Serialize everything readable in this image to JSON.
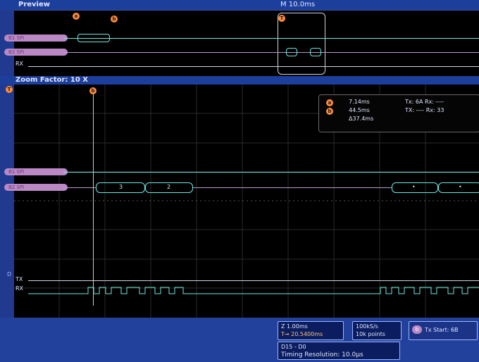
{
  "header": {
    "preview_label": "Preview",
    "time_scale": "M 10.0ms"
  },
  "preview": {
    "bus_b1": "B1 SPI",
    "bus_b2": "B2 SPI",
    "channel_rx": "RX"
  },
  "zoom": {
    "label": "Zoom Factor: 10 X"
  },
  "markers": {
    "a": "a",
    "b": "b",
    "t": "T"
  },
  "cursor_readout": {
    "line1": "7.14ms",
    "line2": "44.5ms",
    "line3": "Δ37.4ms",
    "col1a": "Tx: 6A Rx: ----",
    "col1b": "TX: ---- Rx: 33"
  },
  "bus_labels": {
    "b1": "B1 SPI",
    "b2": "B2 SPI"
  },
  "decode": {
    "packet1": "3",
    "packet2": "2",
    "packet3": "•",
    "packet4": "•"
  },
  "digital": {
    "tx": "TX",
    "rx": "RX",
    "d_label": "D"
  },
  "status": {
    "timebase_line1": "Z 1.00ms",
    "timebase_line2": "T→ 20.5400ms",
    "sample_line1": "100kS/s",
    "sample_line2": "10k points",
    "trigger_label": "Tx Start: 6B",
    "digital_line1": "D15 - D0",
    "digital_line2": "Timing Resolution: 10.0µs"
  }
}
